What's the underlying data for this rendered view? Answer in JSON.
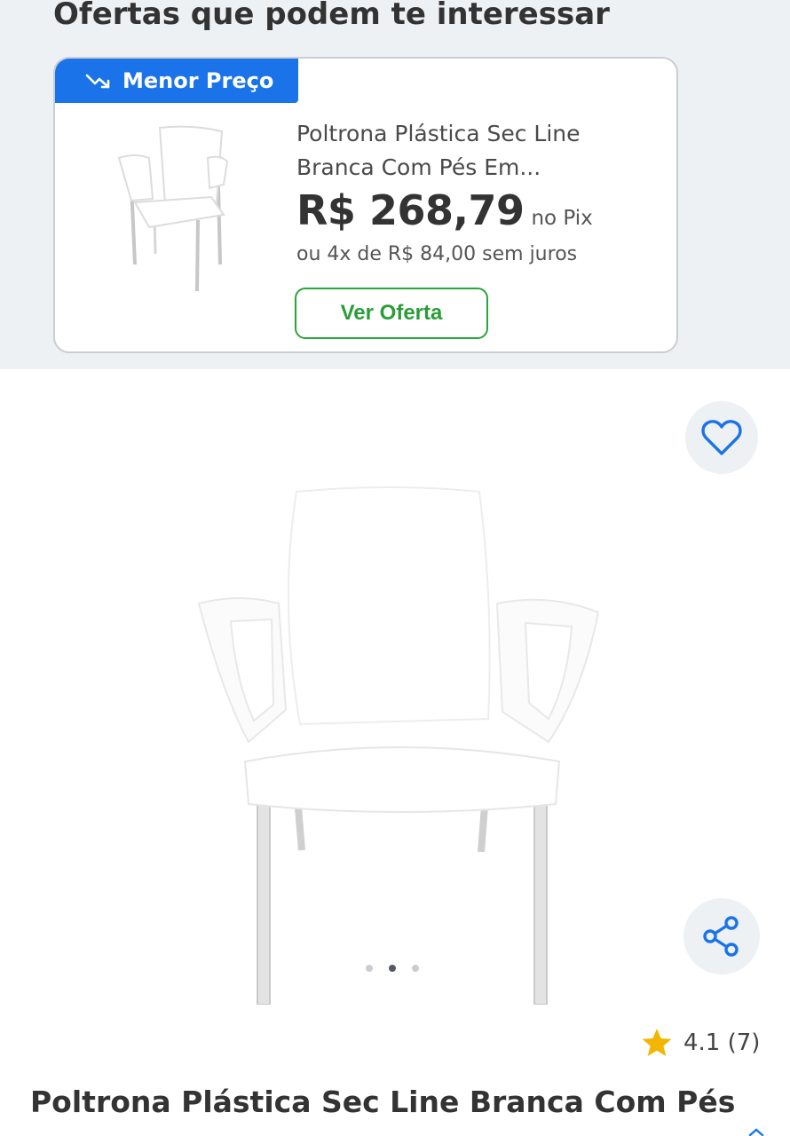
{
  "offers": {
    "title": "Ofertas que podem te interessar",
    "card": {
      "badge_label": "Menor Preço",
      "badge_icon": "trending-down-icon",
      "product_name": "Poltrona Plástica Sec Line Branca Com Pés Em...",
      "price": "R$ 268,79",
      "price_suffix": "no Pix",
      "installments": "ou 4x de R$ 84,00 sem juros",
      "cta_label": "Ver Oferta"
    }
  },
  "product": {
    "favorite_icon": "heart-icon",
    "share_icon": "share-icon",
    "carousel": {
      "total": 3,
      "active": 2
    },
    "rating_icon": "star-icon",
    "rating_text": "4.1 (7)",
    "title": "Poltrona Plástica Sec Line Branca Com Pés"
  },
  "colors": {
    "accent_blue": "#1a73e8",
    "cta_green": "#2a9d38",
    "star_yellow": "#f2b600",
    "section_bg": "#eef1f4"
  }
}
